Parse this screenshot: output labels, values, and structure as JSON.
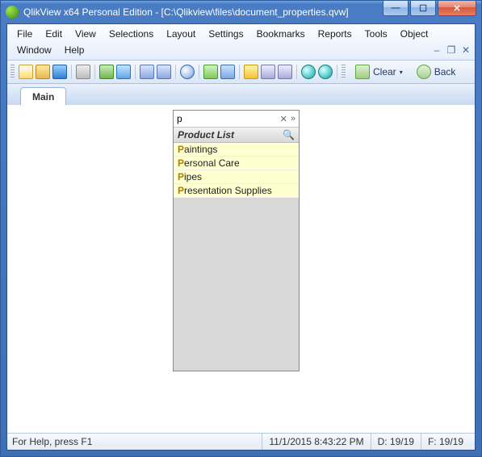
{
  "title": "QlikView x64 Personal Edition - [C:\\Qlikview\\files\\document_properties.qvw]",
  "menus": {
    "row1": [
      "File",
      "Edit",
      "View",
      "Selections",
      "Layout",
      "Settings",
      "Bookmarks",
      "Reports",
      "Tools",
      "Object"
    ],
    "row2": [
      "Window",
      "Help"
    ]
  },
  "toolbar": {
    "clear": "Clear",
    "back": "Back"
  },
  "tab": {
    "main": "Main"
  },
  "listbox": {
    "search_value": "p",
    "caption": "Product List",
    "items": [
      "Paintings",
      "Personal Care",
      "Pipes",
      "Presentation Supplies"
    ]
  },
  "status": {
    "help": "For Help, press F1",
    "time": "11/1/2015 8:43:22 PM",
    "d": "D: 19/19",
    "f": "F: 19/19"
  }
}
